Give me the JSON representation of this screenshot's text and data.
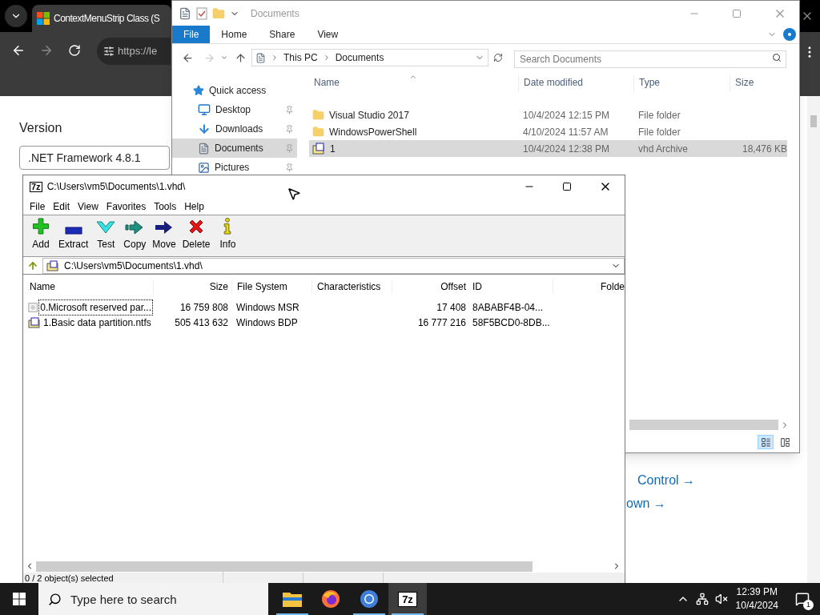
{
  "browser": {
    "tab_title": "ContextMenuStrip Class (S",
    "url": "https://le",
    "version_label": "Version",
    "version_value": ".NET Framework 4.8.1",
    "links": [
      "Control →",
      "own →"
    ]
  },
  "explorer": {
    "title": "Documents",
    "ribbon_tabs": [
      {
        "label": "File",
        "selected": true
      },
      {
        "label": "Home",
        "selected": false
      },
      {
        "label": "Share",
        "selected": false
      },
      {
        "label": "View",
        "selected": false
      }
    ],
    "breadcrumb": [
      "This PC",
      "Documents"
    ],
    "search": {
      "placeholder": "Search Documents"
    },
    "nav": [
      {
        "label": "Quick access",
        "kind": "star",
        "pinned": false,
        "selected": false
      },
      {
        "label": "Desktop",
        "kind": "desktop",
        "pinned": true,
        "selected": false
      },
      {
        "label": "Downloads",
        "kind": "download",
        "pinned": true,
        "selected": false
      },
      {
        "label": "Documents",
        "kind": "document",
        "pinned": true,
        "selected": true
      },
      {
        "label": "Pictures",
        "kind": "pictures",
        "pinned": true,
        "selected": false
      }
    ],
    "columns": [
      "Name",
      "Date modified",
      "Type",
      "Size"
    ],
    "rows": [
      {
        "name": "Visual Studio 2017",
        "date": "10/4/2024 12:15 PM",
        "type": "File folder",
        "kind": "folder",
        "selected": false
      },
      {
        "name": "WindowsPowerShell",
        "date": "4/10/2024 11:57 AM",
        "type": "File folder",
        "kind": "folder",
        "selected": false
      },
      {
        "name": "1",
        "date": "10/4/2024 12:38 PM",
        "type": "vhd Archive",
        "size": "18,476 KB",
        "kind": "vhd",
        "selected": true
      }
    ],
    "views": [
      {
        "kind": "details",
        "selected": true
      },
      {
        "kind": "thumbnails",
        "selected": false
      }
    ]
  },
  "sevenzip": {
    "logo": "7z",
    "title": "C:\\Users\\vm5\\Documents\\1.vhd\\",
    "menu": [
      "File",
      "Edit",
      "View",
      "Favorites",
      "Tools",
      "Help"
    ],
    "toolbar": [
      {
        "label": "Add",
        "kind": "add"
      },
      {
        "label": "Extract",
        "kind": "extract"
      },
      {
        "label": "Test",
        "kind": "test"
      },
      {
        "label": "Copy",
        "kind": "copy"
      },
      {
        "label": "Move",
        "kind": "move"
      },
      {
        "label": "Delete",
        "kind": "delete"
      },
      {
        "label": "Info",
        "kind": "info"
      }
    ],
    "path": "C:\\Users\\vm5\\Documents\\1.vhd\\",
    "columns": [
      "Name",
      "Size",
      "File System",
      "Characteristics",
      "Offset",
      "ID",
      "Folde"
    ],
    "rows": [
      {
        "name": "0.Microsoft reserved par...",
        "size": "16 759 808",
        "file_system": "Windows MSR",
        "offset": "17 408",
        "id": "8ABABF4B-04...",
        "kind": "disk",
        "focused": true
      },
      {
        "name": "1.Basic data partition.ntfs",
        "size": "505 413 632",
        "file_system": "Windows BDP",
        "offset": "16 777 216",
        "id": "58F5BCD0-8DB...",
        "kind": "ntfs",
        "focused": false
      }
    ],
    "status": "0 / 2 object(s) selected"
  },
  "taskbar": {
    "search_placeholder": "Type here to search",
    "apps": [
      {
        "kind": "explorer",
        "running": true,
        "selected": false
      },
      {
        "kind": "firefox",
        "running": false,
        "selected": false
      },
      {
        "kind": "chrome",
        "running": true,
        "selected": false
      },
      {
        "kind": "sevenzip",
        "label": "7z",
        "running": true,
        "selected": true
      }
    ],
    "time": "12:39 PM",
    "date": "10/4/2024",
    "notifications": "1"
  }
}
